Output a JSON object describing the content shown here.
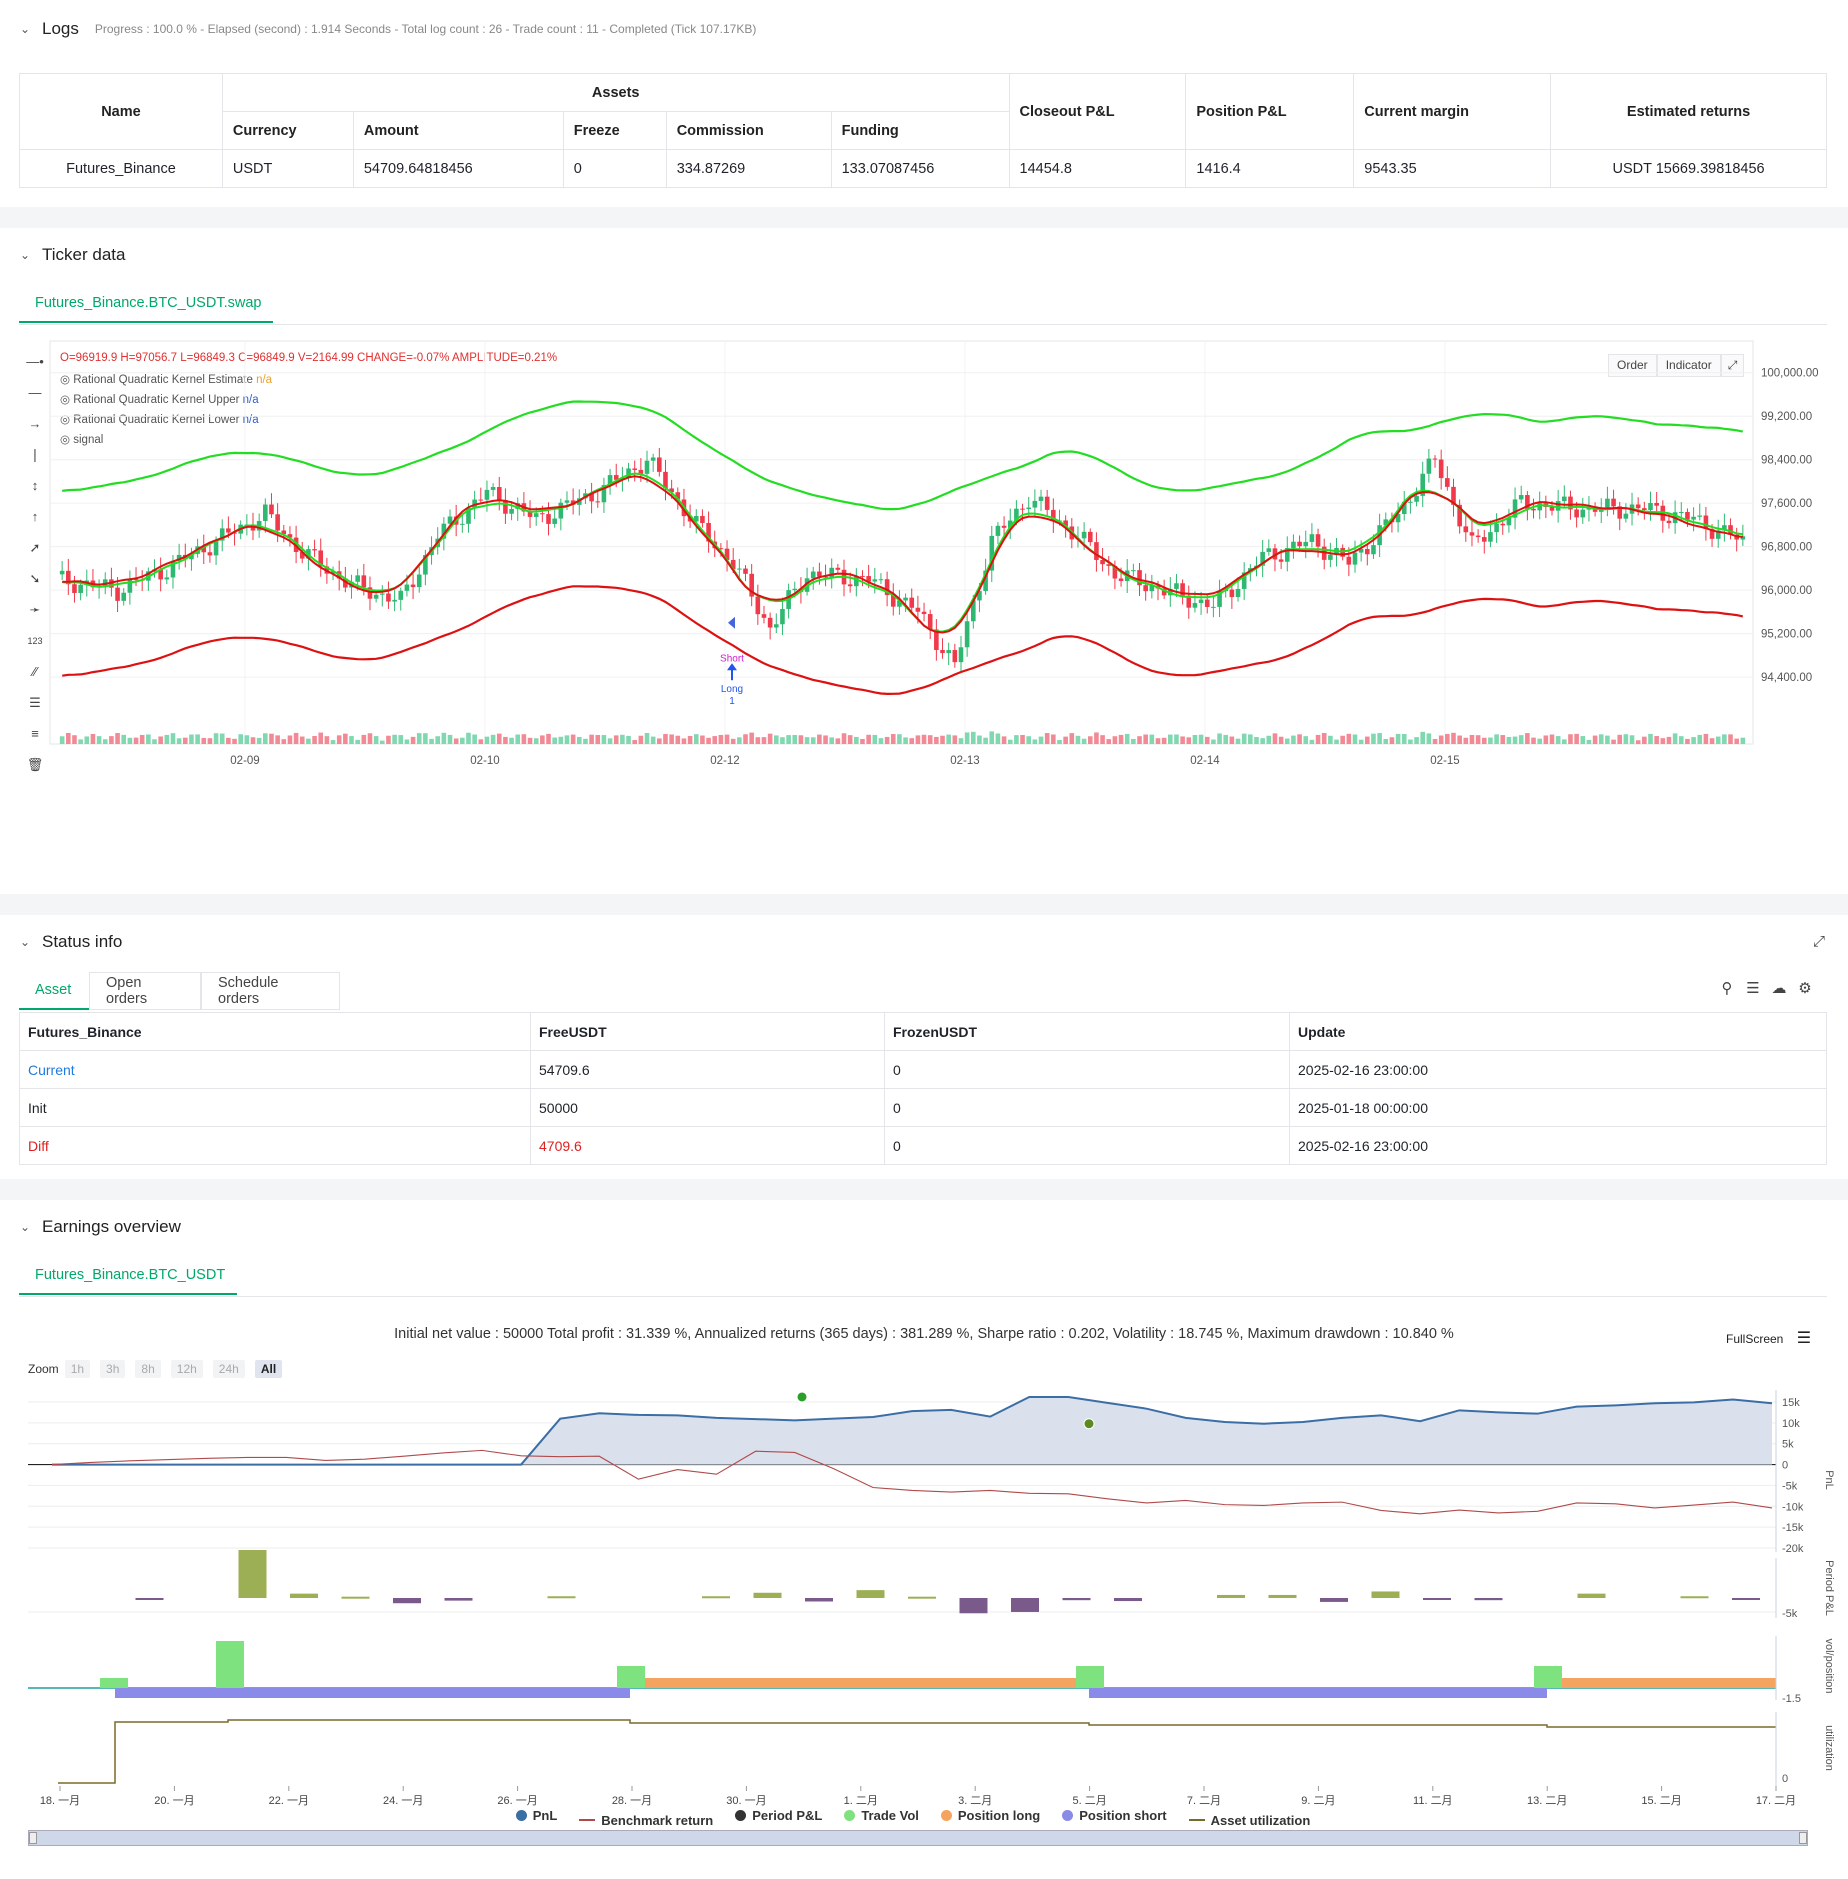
{
  "logs": {
    "title": "Logs",
    "summary": "Progress : 100.0 % - Elapsed (second) : 1.914  Seconds - Total log count : 26 - Trade count : 11 - Completed (Tick 107.17KB)",
    "headers": {
      "name": "Name",
      "assets": "Assets",
      "currency": "Currency",
      "amount": "Amount",
      "freeze": "Freeze",
      "commission": "Commission",
      "funding": "Funding",
      "closeout": "Closeout P&L",
      "position": "Position P&L",
      "margin": "Current margin",
      "returns": "Estimated returns"
    },
    "row": {
      "name": "Futures_Binance",
      "currency": "USDT",
      "amount": "54709.64818456",
      "freeze": "0",
      "commission": "334.87269",
      "funding": "133.07087456",
      "closeout": "14454.8",
      "position": "1416.4",
      "margin": "9543.35",
      "returns": "USDT 15669.39818456"
    }
  },
  "ticker": {
    "title": "Ticker data",
    "tab": "Futures_Binance.BTC_USDT.swap",
    "ohlc": "O=96919.9 H=97056.7 L=96849.3 C=96849.9 V=2164.99 CHANGE=-0.07% AMPLITUDE=0.21%",
    "indicators": [
      {
        "label": "Rational Quadratic Kernel Estimate",
        "value": "n/a",
        "color": "#f0a020"
      },
      {
        "label": "Rational Quadratic Kernel Upper",
        "value": "n/a",
        "color": "#3060d0"
      },
      {
        "label": "Rational Quadratic Kernel Lower",
        "value": "n/a",
        "color": "#3060d0"
      },
      {
        "label": "signal",
        "value": "",
        "color": "#555"
      }
    ],
    "buttons": {
      "order": "Order",
      "indicator": "Indicator"
    },
    "yticks": [
      "100,000.00",
      "99,200.00",
      "98,400.00",
      "97,600.00",
      "96,800.00",
      "96,000.00",
      "95,200.00",
      "94,400.00"
    ],
    "xticks": [
      "02-09",
      "02-10",
      "02-12",
      "02-13",
      "02-14",
      "02-15"
    ],
    "markers": {
      "short": "Short",
      "long": "Long",
      "long_count": "1"
    }
  },
  "status": {
    "title": "Status info",
    "tabs": [
      "Asset",
      "Open orders",
      "Schedule orders"
    ],
    "headers": [
      "Futures_Binance",
      "FreeUSDT",
      "FrozenUSDT",
      "Update"
    ],
    "rows": [
      {
        "label": "Current",
        "free": "54709.6",
        "frozen": "0",
        "update": "2025-02-16 23:00:00"
      },
      {
        "label": "Init",
        "free": "50000",
        "frozen": "0",
        "update": "2025-01-18 00:00:00"
      },
      {
        "label": "Diff",
        "free": "4709.6",
        "frozen": "0",
        "update": "2025-02-16 23:00:00"
      }
    ]
  },
  "earnings": {
    "title": "Earnings overview",
    "tab": "Futures_Binance.BTC_USDT",
    "summary": "Initial net value : 50000 Total profit : 31.339 %, Annualized returns (365 days) : 381.289 %, Sharpe ratio : 0.202, Volatility : 18.745 %, Maximum drawdown : 10.840 %",
    "fullscreen": "FullScreen",
    "zoom_label": "Zoom",
    "zoom_options": [
      "1h",
      "3h",
      "8h",
      "12h",
      "24h",
      "All"
    ],
    "pnl_ticks": [
      "15k",
      "10k",
      "5k",
      "0",
      "-5k",
      "-10k",
      "-15k",
      "-20k"
    ],
    "period_ticks": [
      "-5k"
    ],
    "vol_ticks": [
      "-1.5"
    ],
    "util_ticks": [
      "0"
    ],
    "axis_labels": {
      "pnl": "PnL",
      "period": "Period P&L",
      "vol": "vol/position",
      "util": "utilization"
    },
    "xticks": [
      "18. 一月",
      "20. 一月",
      "22. 一月",
      "24. 一月",
      "26. 一月",
      "28. 一月",
      "30. 一月",
      "1. 二月",
      "3. 二月",
      "5. 二月",
      "7. 二月",
      "9. 二月",
      "11. 二月",
      "13. 二月",
      "15. 二月",
      "17. 二月"
    ],
    "legend": [
      {
        "label": "PnL",
        "color": "#3a6ea5",
        "kind": "dot"
      },
      {
        "label": "Benchmark return",
        "color": "#b04a4a",
        "kind": "line"
      },
      {
        "label": "Period P&L",
        "color": "#333333",
        "kind": "dot"
      },
      {
        "label": "Trade Vol",
        "color": "#7ee27e",
        "kind": "dot"
      },
      {
        "label": "Position long",
        "color": "#f4a460",
        "kind": "dot"
      },
      {
        "label": "Position short",
        "color": "#8a8ae8",
        "kind": "dot"
      },
      {
        "label": "Asset utilization",
        "color": "#7a6a2a",
        "kind": "line"
      }
    ]
  },
  "colors": {
    "green": "#00a86b",
    "up": "#2eb872",
    "down": "#f0394a",
    "kernel_green": "#22dd22",
    "kernel_red": "#dd1111"
  }
}
